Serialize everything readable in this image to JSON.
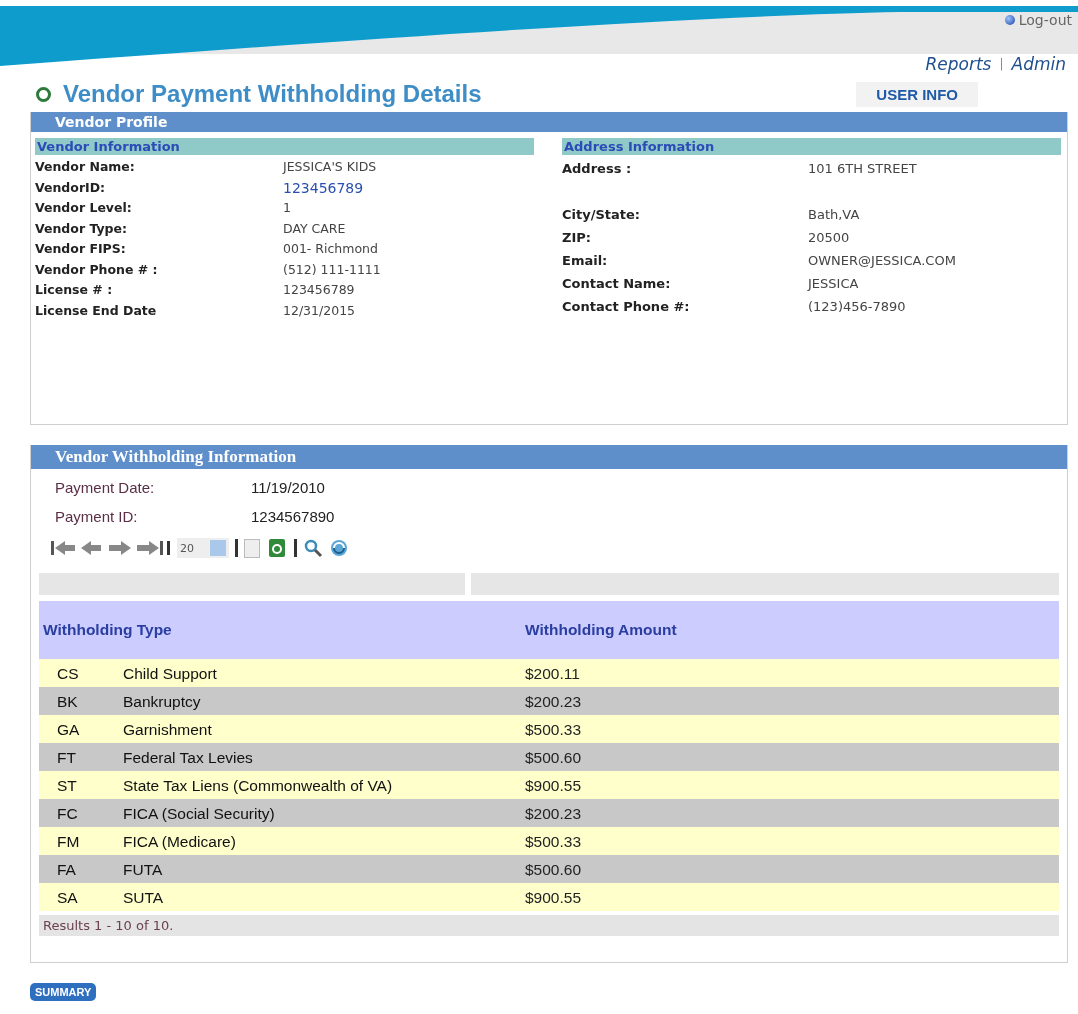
{
  "header": {
    "logout": "Log-out",
    "links": [
      "Reports",
      "Admin"
    ],
    "separator": "|"
  },
  "title": "Vendor Payment Withholding Details",
  "user_info": "USER INFO",
  "vendor_profile": {
    "title": "Vendor Profile",
    "vendor_information": {
      "title": "Vendor Information",
      "fields": [
        {
          "label": "Vendor Name:",
          "value": "JESSICA'S KIDS"
        },
        {
          "label": "VendorID:",
          "value": "123456789",
          "kind": "link"
        },
        {
          "label": "Vendor Level:",
          "value": "1"
        },
        {
          "label": "Vendor Type:",
          "value": "DAY CARE"
        },
        {
          "label": "Vendor FIPS:",
          "value": "001- Richmond"
        },
        {
          "label": "Vendor Phone # :",
          "value": "(512) 111-1111"
        },
        {
          "label": "License # :",
          "value": "123456789"
        },
        {
          "label": "License End Date",
          "value": "12/31/2015"
        }
      ]
    },
    "address_information": {
      "title": "Address Information",
      "fields": [
        {
          "label": "Address :",
          "value": "101 6TH STREET"
        },
        {
          "label": "City/State:",
          "value": "Bath,VA",
          "kind": "gap"
        },
        {
          "label": "ZIP:",
          "value": "20500"
        },
        {
          "label": "Email:",
          "value": "OWNER@JESSICA.COM"
        },
        {
          "label": "Contact Name:",
          "value": "JESSICA"
        },
        {
          "label": "Contact Phone #:",
          "value": "(123)456-7890"
        }
      ]
    }
  },
  "withholding": {
    "title": "Vendor Withholding Information",
    "payment_fields": [
      {
        "label": "Payment Date:",
        "value": "11/19/2010"
      },
      {
        "label": "Payment ID:",
        "value": "1234567890"
      }
    ],
    "page_size": "20",
    "table": {
      "columns": [
        "Withholding Type",
        "Withholding Amount"
      ],
      "rows": [
        {
          "code": "CS",
          "type": "Child Support",
          "amount": "$200.11"
        },
        {
          "code": "BK",
          "type": "Bankruptcy",
          "amount": "$200.23"
        },
        {
          "code": "GA",
          "type": "Garnishment",
          "amount": "$500.33"
        },
        {
          "code": "FT",
          "type": "Federal Tax Levies",
          "amount": "$500.60"
        },
        {
          "code": "ST",
          "type": "State Tax Liens (Commonwealth of VA)",
          "amount": "$900.55"
        },
        {
          "code": "FC",
          "type": "FICA (Social Security)",
          "amount": "$200.23"
        },
        {
          "code": "FM",
          "type": "FICA (Medicare)",
          "amount": "$500.33"
        },
        {
          "code": "FA",
          "type": "FUTA",
          "amount": "$500.60"
        },
        {
          "code": "SA",
          "type": "SUTA",
          "amount": "$900.55"
        }
      ]
    },
    "results": "Results 1 - 10 of 10."
  },
  "summary_button": "SUMMARY"
}
